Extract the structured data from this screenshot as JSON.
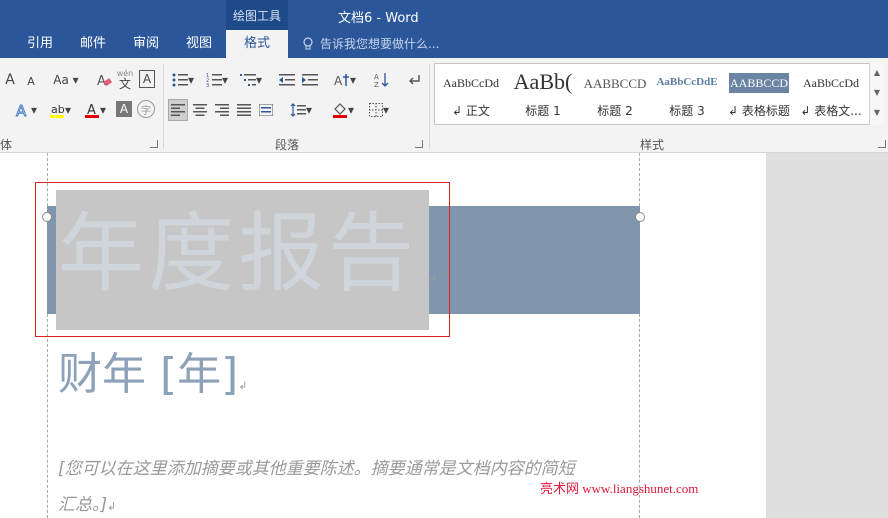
{
  "window": {
    "title": "文档6 - Word",
    "context_group": "绘图工具"
  },
  "tabs": [
    {
      "label": "引用"
    },
    {
      "label": "邮件"
    },
    {
      "label": "审阅"
    },
    {
      "label": "视图"
    },
    {
      "label": "格式"
    }
  ],
  "tell_me": {
    "placeholder": "告诉我您想要做什么..."
  },
  "ribbon": {
    "font_group_label": "体",
    "paragraph_group_label": "段落",
    "styles_group_label": "样式",
    "font_buttons": {
      "grow": "A",
      "shrink": "A",
      "case": "Aa",
      "pinyin": "wén",
      "border_char": "A"
    },
    "styles": [
      {
        "sample": "AaBbCcDd",
        "name": "正文",
        "color": "#333333"
      },
      {
        "sample": "AaBb(",
        "name": "标题 1",
        "color": "#333333"
      },
      {
        "sample": "AABBCCD",
        "name": "标题 2",
        "color": "#555555"
      },
      {
        "sample": "AaBbCcDdE",
        "name": "标题 3",
        "color": "#5b7ca0"
      },
      {
        "sample": "AABBCCD",
        "name": "表格标题",
        "color": "#ffffff"
      },
      {
        "sample": "AaBbCcDd",
        "name": "表格文...",
        "color": "#333333"
      }
    ]
  },
  "document": {
    "title": "年度报告",
    "subtitle": "财年 [年]",
    "abstract_line1": "[您可以在这里添加摘要或其他重要陈述。摘要通常是文档内容的简短",
    "abstract_line2": "汇总。]"
  },
  "watermark": "亮术网 www.liangshunet.com"
}
